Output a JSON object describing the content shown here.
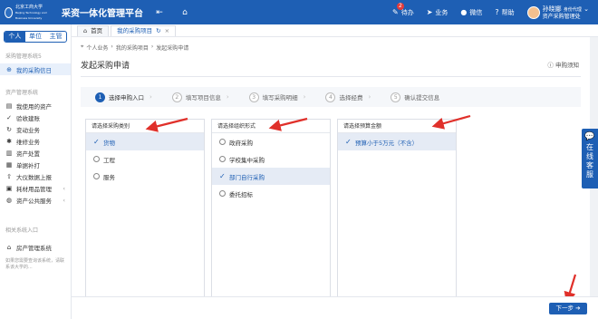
{
  "header": {
    "logo_text": "北京工商大学",
    "logo_sub": "Beijing Technology and Business University",
    "app_title": "采资一体化管理平台",
    "todo_label": "待办",
    "todo_count": "2",
    "business_label": "业务",
    "wechat_label": "微信",
    "help_label": "帮助",
    "user_name": "孙晓娜",
    "user_role": "身份代理",
    "user_dept": "资产采购管理处"
  },
  "sidebar": {
    "switch": [
      "个人",
      "单位",
      "主管"
    ],
    "sec1": "采购管理系统5",
    "item_my_purchase": "我的采购信日",
    "sec2": "资产管理系统",
    "items": [
      {
        "label": "我使用的资产",
        "icon": "doc-icon"
      },
      {
        "label": "验收建账",
        "icon": "check-icon"
      },
      {
        "label": "变动业务",
        "icon": "refresh-icon"
      },
      {
        "label": "维修业务",
        "icon": "wrench-icon"
      },
      {
        "label": "资产处置",
        "icon": "trash-icon"
      },
      {
        "label": "单据补打",
        "icon": "print-icon"
      },
      {
        "label": "大仪数据上报",
        "icon": "upload-icon"
      },
      {
        "label": "耗材用品管理",
        "icon": "box-icon"
      },
      {
        "label": "资产公共服务",
        "icon": "globe-icon"
      }
    ],
    "sec3": "相关系统入口",
    "item_house": "房产管理系统",
    "note": "如果您需要查询该系统，请联系该大学的..."
  },
  "tabs": [
    {
      "label": "首页"
    },
    {
      "label": "我的采购项目"
    }
  ],
  "main": {
    "breadcrumb": [
      "个人业务",
      "我的采购项目",
      "发起采购申请"
    ],
    "title": "发起采购申请",
    "help_link": "申购须知",
    "steps": [
      {
        "num": "1",
        "label": "选择申购入口"
      },
      {
        "num": "2",
        "label": "填写项目信息"
      },
      {
        "num": "3",
        "label": "填写采购明细"
      },
      {
        "num": "4",
        "label": "选择经费"
      },
      {
        "num": "5",
        "label": "确认提交信息"
      }
    ],
    "panels": [
      {
        "header": "请选择采购类别",
        "options": [
          "货物",
          "工程",
          "服务"
        ],
        "selected": 0
      },
      {
        "header": "请选择组织形式",
        "options": [
          "政府采购",
          "学校集中采购",
          "部门自行采购",
          "委托招标"
        ],
        "selected": 2
      },
      {
        "header": "请选择预算金额",
        "options": [
          "预算小于5万元（不含）"
        ],
        "selected": 0
      }
    ]
  },
  "footer": {
    "next_label": "下一步"
  },
  "float_service": "在线客服",
  "colors": {
    "primary": "#1e5fb4",
    "annotation": "#e0302a"
  }
}
